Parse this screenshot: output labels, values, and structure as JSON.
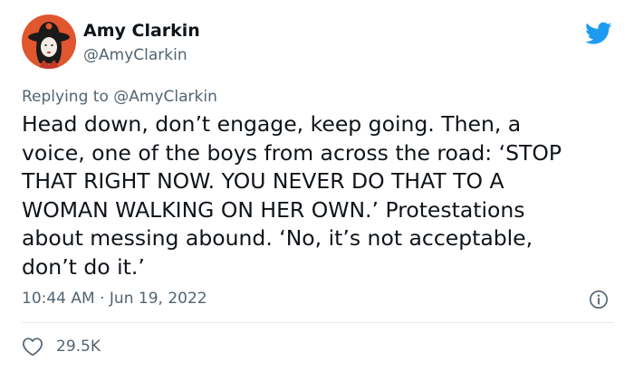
{
  "author": {
    "display_name": "Amy Clarkin",
    "handle": "@AmyClarkin"
  },
  "reply": {
    "prefix": "Replying to ",
    "mention": "@AmyClarkin"
  },
  "tweet": {
    "lines": [
      "Head down, don’t engage, keep going. Then, a",
      "voice, one of the boys from across the road: ‘STOP",
      "THAT RIGHT NOW. YOU NEVER DO THAT TO A",
      "WOMAN WALKING ON HER OWN.’ Protestations",
      "about messing abound. ‘No, it’s not acceptable,",
      "don’t do it.’"
    ]
  },
  "meta": {
    "time": "10:44 AM",
    "separator": " · ",
    "date": "Jun 19, 2022"
  },
  "engagement": {
    "likes": "29.5K"
  },
  "icons": {
    "brand": "twitter-bird-icon",
    "info": "info-icon",
    "like": "heart-icon"
  },
  "colors": {
    "brand_blue": "#1d9bf0",
    "text_primary": "#0f1419",
    "text_secondary": "#536471",
    "divider": "#e7e9ea",
    "avatar_bg": "#e0562e"
  }
}
